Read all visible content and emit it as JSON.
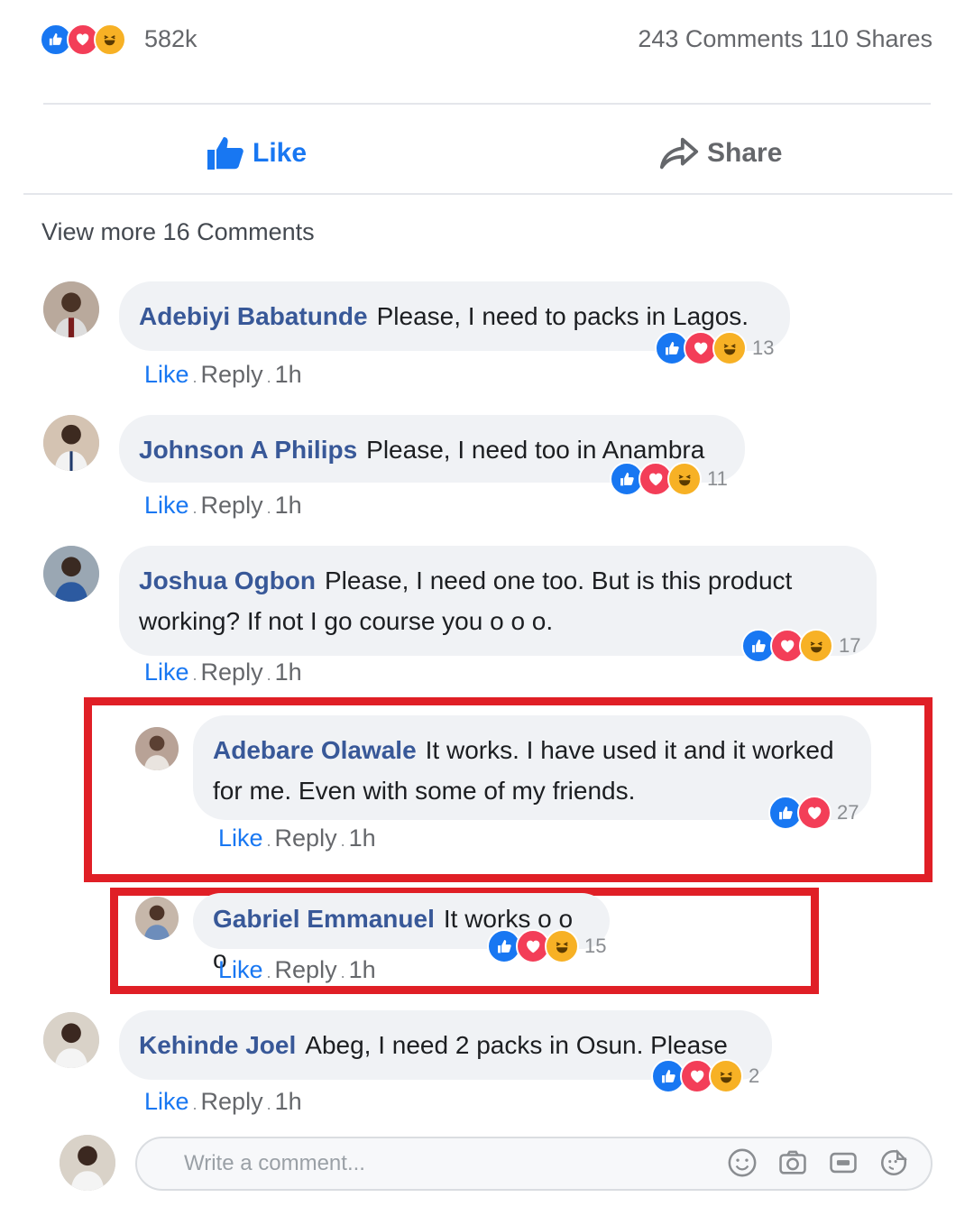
{
  "post_stats": {
    "reaction_count": "582k",
    "comments_shares": "243 Comments 110 Shares"
  },
  "actions": {
    "like_label": "Like",
    "share_label": "Share"
  },
  "view_more": "View more 16 Comments",
  "comments": [
    {
      "author": "Adebiyi Babatunde",
      "text": "Please, I need to packs in Lagos.",
      "reactions": "13",
      "like": "Like",
      "reply": "Reply",
      "time": "1h"
    },
    {
      "author": "Johnson A Philips",
      "text": "Please, I need too in Anambra",
      "reactions": "11",
      "like": "Like",
      "reply": "Reply",
      "time": "1h"
    },
    {
      "author": "Joshua Ogbon",
      "text": "Please, I need one too. But is this product working? If not I go course you o o o.",
      "reactions": "17",
      "like": "Like",
      "reply": "Reply",
      "time": "1h"
    },
    {
      "author": "Adebare Olawale",
      "text": "It works. I have used it and it worked for me. Even with some of my friends.",
      "reactions": "27",
      "like": "Like",
      "reply": "Reply",
      "time": "1h"
    },
    {
      "author": "Gabriel Emmanuel",
      "text": "It works o o o",
      "reactions": "15",
      "like": "Like",
      "reply": "Reply",
      "time": "1h"
    },
    {
      "author": "Kehinde Joel",
      "text": "Abeg, I need 2 packs in Osun. Please",
      "reactions": "2",
      "like": "Like",
      "reply": "Reply",
      "time": "1h"
    }
  ],
  "composer": {
    "placeholder": "Write a comment...",
    "icons": [
      "emoji-icon",
      "camera-icon",
      "gif-icon",
      "sticker-icon"
    ]
  },
  "colors": {
    "like_blue": "#1877f2",
    "love_red": "#f33e58",
    "haha_yellow": "#f7b125",
    "author_blue": "#385898",
    "highlight_red": "#e01f26"
  }
}
